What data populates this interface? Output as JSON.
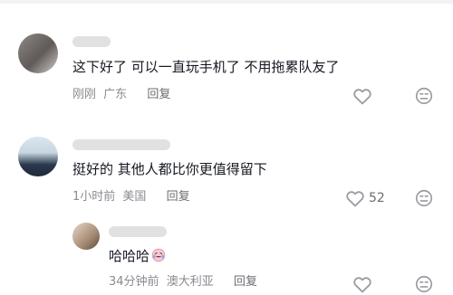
{
  "comments": [
    {
      "text": "这下好了 可以一直玩手机了 不用拖累队友了",
      "time": "刚刚",
      "location": "广东",
      "reply_label": "回复",
      "likes": ""
    },
    {
      "text": "挺好的 其他人都比你更值得留下",
      "time": "1小时前",
      "location": "美国",
      "reply_label": "回复",
      "likes": "52"
    },
    {
      "text": "哈哈哈",
      "time": "34分钟前",
      "location": "澳大利亚",
      "reply_label": "回复",
      "likes": ""
    }
  ],
  "icons": {
    "like": "heart-outline-icon",
    "dislike": "dislike-face-icon",
    "emoji": "laughing-crying-emoji"
  },
  "colors": {
    "text": "#161823",
    "meta": "#8a8b91",
    "icon": "#9a9ba1"
  }
}
